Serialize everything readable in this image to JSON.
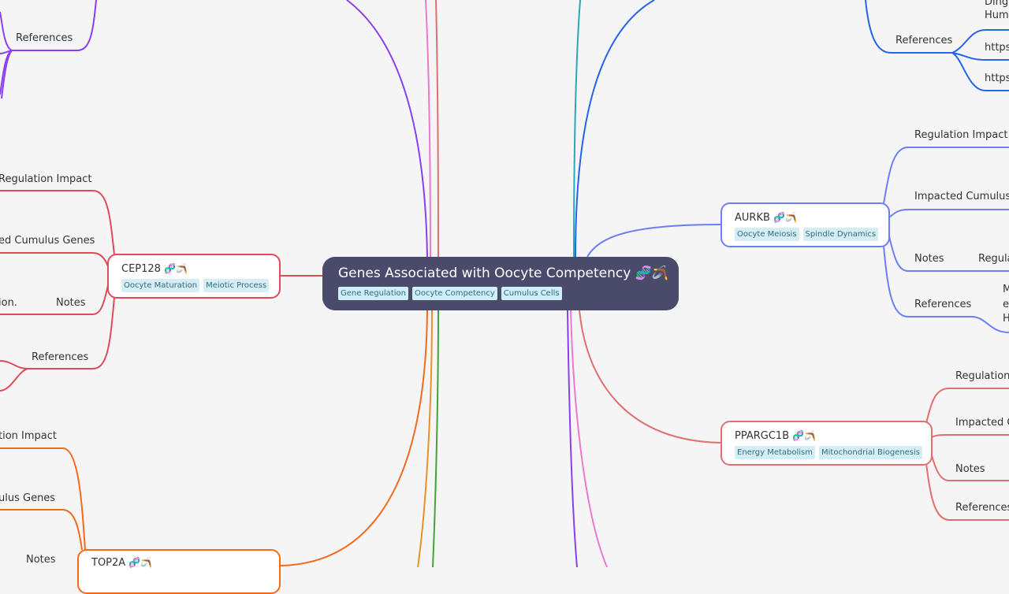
{
  "root": {
    "title": "Genes Associated with Oocyte Competency",
    "emoji": "🧬🪃",
    "tags": [
      "Gene Regulation",
      "Oocyte Competency",
      "Cumulus Cells"
    ]
  },
  "nodes": {
    "cep128": {
      "title": "CEP128",
      "emoji": "🧬🪃",
      "tags": [
        "Oocyte Maturation",
        "Meiotic Process"
      ],
      "color": "#e04a5a"
    },
    "top2a": {
      "title": "TOP2A",
      "emoji": "🧬🪃",
      "tags": [],
      "color": "#f26b1d"
    },
    "aurkb": {
      "title": "AURKB",
      "emoji": "🧬🪃",
      "tags": [
        "Oocyte Meiosis",
        "Spindle Dynamics"
      ],
      "color": "#6d7ff5"
    },
    "ppargc1b": {
      "title": "PPARGC1B",
      "emoji": "🧬🪃",
      "tags": [
        "Energy Metabolism",
        "Mitochondrial Biogenesis"
      ],
      "color": "#e07070"
    }
  },
  "labels": {
    "topleft_references": "References",
    "cep_regulation": "Regulation Impact",
    "cep_impacted": "ed Cumulus Genes",
    "cep_notes_text": "ion.",
    "cep_notes": "Notes",
    "cep_references": "References",
    "top2a_regulation": "tion Impact",
    "top2a_impacted": "ulus Genes",
    "top2a_notes": "Notes",
    "topright_ref_text1": "Ding,",
    "topright_ref_text2": "Huma",
    "topright_references": "References",
    "topright_https1": "https",
    "topright_https2": "https",
    "aurkb_regulation": "Regulation Impact",
    "aurkb_impacted": "Impacted Cumulus G",
    "aurkb_notes": "Notes",
    "aurkb_notes_text": "Regula",
    "aurkb_references": "References",
    "aurkb_ref_text1": "M",
    "aurkb_ref_text2": "ea",
    "aurkb_ref_text3": "H",
    "pp_regulation": "Regulation",
    "pp_impacted": "Impacted C",
    "pp_notes": "Notes",
    "pp_references": "References"
  },
  "colors": {
    "background": "#f5f5f5",
    "root_bg": "#4a4b6a",
    "purple": "#8a3ff0",
    "pink": "#ea7ad0",
    "salmon": "#e07070",
    "teal": "#2aa8b8",
    "blue": "#2563eb",
    "orange": "#f26b1d",
    "amber": "#e8902a",
    "green": "#45a33a",
    "red": "#e04a5a",
    "periwinkle": "#6d7ff5"
  }
}
